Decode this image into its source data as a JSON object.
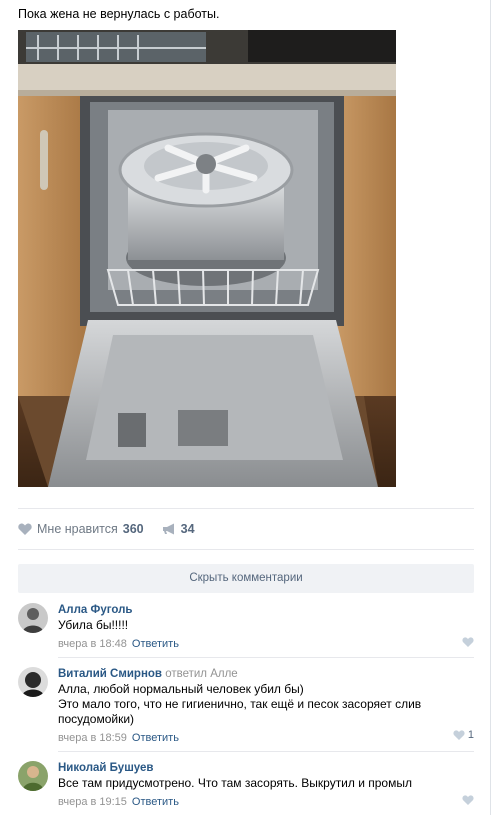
{
  "post": {
    "text": "Пока жена не вернулась с работы.",
    "photo": "photo of an alloy car wheel rim placed in the rack of an open dishwasher"
  },
  "actions": {
    "like_label": "Мне нравится",
    "like_count": "360",
    "share_count": "34",
    "like_icon": "heart-icon",
    "share_icon": "megaphone-icon"
  },
  "comments_bar": {
    "hide_label": "Скрыть комментарии"
  },
  "comments": [
    {
      "author": "Алла Фуголь",
      "reply_to": "",
      "text": "Убила бы!!!!!",
      "time": "вчера в 18:48",
      "reply_label": "Ответить",
      "likes": ""
    },
    {
      "author": "Виталий Смирнов",
      "reply_to": "ответил Алле",
      "text_lines": [
        "Алла, любой нормальный человек убил бы)",
        "Это мало того, что не гигиенично, так ещё и песок засоряет слив",
        "посудомойки)"
      ],
      "time": "вчера в 18:59",
      "reply_label": "Ответить",
      "likes": "1"
    },
    {
      "author": "Николай Бушуев",
      "reply_to": "",
      "text": "Все там придусмотрено. Что там засорять. Выкрутил и промыл",
      "time": "вчера в 19:15",
      "reply_label": "Ответить",
      "likes": ""
    }
  ],
  "colors": {
    "link": "#2a5885",
    "meta": "#939393",
    "action": "#6f7985",
    "bar_bg": "#f0f2f5"
  }
}
